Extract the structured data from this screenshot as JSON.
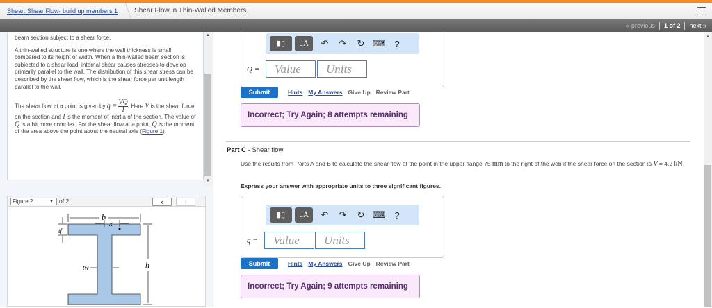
{
  "header": {
    "breadcrumb_link": "Shear: Shear Flow- build up members 1",
    "title": "Shear Flow in Thin-Walled Members"
  },
  "nav": {
    "previous": "« previous",
    "page": "1 of 2",
    "next": "next »"
  },
  "intro": {
    "top_line": "beam section subject to a shear force.",
    "para1": "A thin-walled structure is one where the wall thickness is small compared to its height or width. When a thin-walled beam section is subjected to a shear load, internal shear causes stresses to develop primarily parallel to the wall. The distribution of this shear stress can be described by the shear flow, which is the shear force per unit length parallel to the wall.",
    "para2_a": "The shear flow at a point is given by ",
    "eq_lhs": "q =",
    "eq_num": "VQ",
    "eq_den": "I",
    "para2_b": ". Here ",
    "V": "V",
    "para2_c": " is the shear force on the section and ",
    "I": "I",
    "para2_d": " is the moment of inertia of the section. The value of ",
    "Q": "Q",
    "para2_e": " is a bit more complex. For the shear flow at a point, ",
    "para2_f": " is the moment of the area above the point about the neutral axis (",
    "fig_link": "Figure 1",
    "para2_g": ")."
  },
  "figure": {
    "selected": "Figure 2",
    "of": "of 2",
    "prev": "‹",
    "next": "›",
    "labels": {
      "b": "b",
      "x": "x",
      "tf": "tf",
      "tw": "tw",
      "h": "h"
    }
  },
  "toolbar": {
    "template": "▮▯",
    "units": "μÅ",
    "undo": "↶",
    "redo": "↷",
    "reset": "↻",
    "keyboard": "⌨",
    "help": "?"
  },
  "partB": {
    "label": "Q =",
    "value_placeholder": "Value",
    "units_placeholder": "Units",
    "submit": "Submit",
    "hints": "Hints",
    "my_answers": "My Answers",
    "give_up": "Give Up",
    "review": "Review Part",
    "feedback": "Incorrect; Try Again; 8 attempts remaining"
  },
  "partC": {
    "title": "Part C",
    "subtitle": "Shear flow",
    "question_a": "Use the results from Parts A and B to calculate the shear flow at the point in the upper flange 75 ",
    "unit_mm": "mm",
    "question_b": " to the right of the web if the shear force on the section is ",
    "V": "V",
    "question_c": " = 4.2 ",
    "unit_kN": "kN",
    "question_d": ".",
    "instruction": "Express your answer with appropriate units to three significant figures.",
    "label": "q =",
    "value_placeholder": "Value",
    "units_placeholder": "Units",
    "submit": "Submit",
    "hints": "Hints",
    "my_answers": "My Answers",
    "give_up": "Give Up",
    "review": "Review Part",
    "feedback": "Incorrect; Try Again; 9 attempts remaining"
  },
  "colors": {
    "accent": "#f68b1f",
    "submit": "#1a73c7",
    "feedback_bg": "#f9e9fb",
    "beam": "#a9c8e8"
  }
}
